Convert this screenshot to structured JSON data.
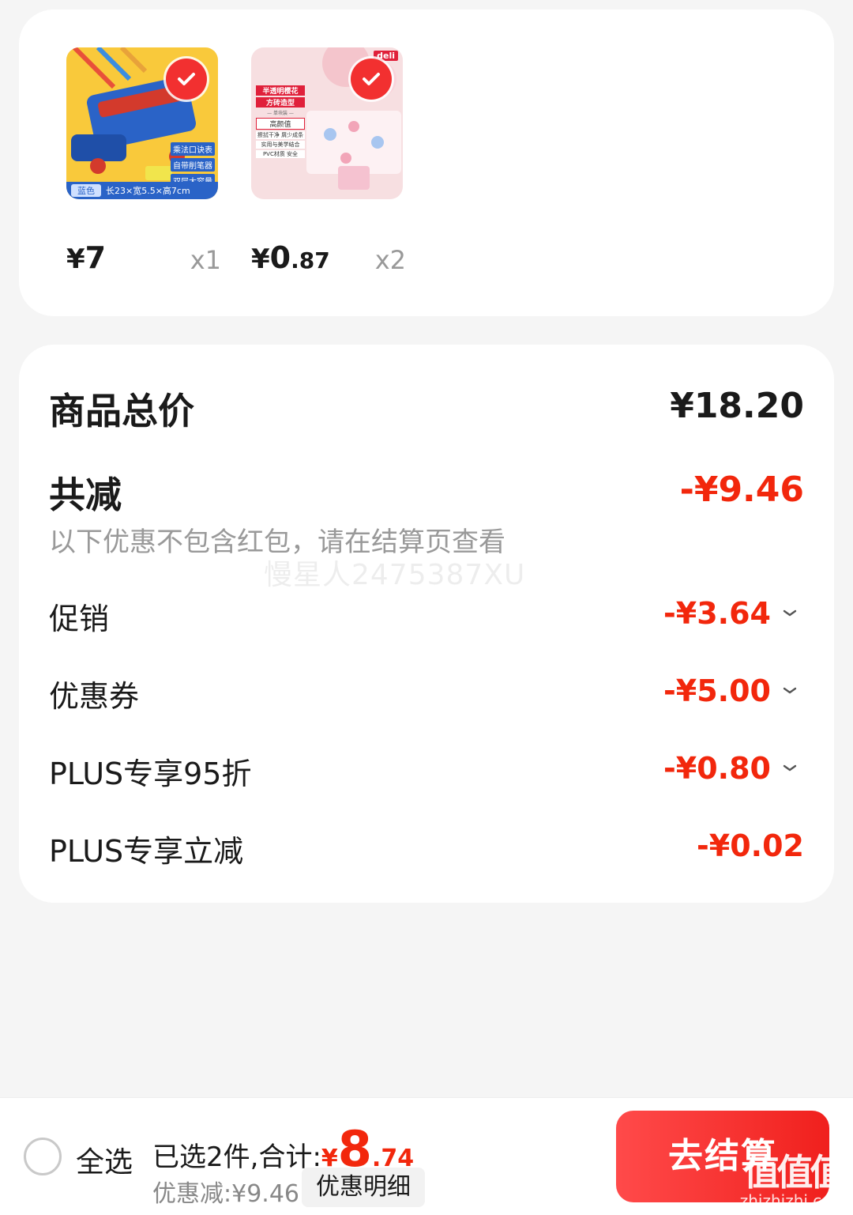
{
  "products": [
    {
      "price_currency": "¥",
      "price_int": "7",
      "price_dec": "",
      "qty": "x1",
      "thumb_labels": [
        "乘法口诀表",
        "自带削笔器",
        "双层大容量"
      ],
      "thumb_footer": [
        "蓝色",
        "长23×宽5.5×高7cm"
      ]
    },
    {
      "price_currency": "¥",
      "price_int": "0",
      "price_dec": ".87",
      "qty": "x2",
      "thumb_brand": "deli",
      "thumb_labels": [
        "半透明樱花",
        "方砖造型",
        "— 单块装 —",
        "高颜值",
        "擦拭干净 屑少成条",
        "实用与美学结合",
        "PVC材质 安全"
      ]
    }
  ],
  "summary": {
    "total_label": "商品总价",
    "total_value": "¥18.20",
    "reduce_label": "共减",
    "reduce_value": "-¥9.46",
    "note": "以下优惠不包含红包，请在结算页查看",
    "watermark": "慢星人2475387XU",
    "items": [
      {
        "label": "促销",
        "value": "-¥3.64",
        "chevron": true
      },
      {
        "label": "优惠券",
        "value": "-¥5.00",
        "chevron": true
      },
      {
        "label": "PLUS专享95折",
        "value": "-¥0.80",
        "chevron": true
      },
      {
        "label": "PLUS专享立减",
        "value": "-¥0.02",
        "chevron": false
      }
    ]
  },
  "bottom_bar": {
    "select_all": "全选",
    "selected_text": "已选2件,合计:",
    "total_currency": "¥",
    "total_int": "8",
    "total_dec": ".74",
    "discount_text": "优惠减:¥9.46",
    "detail_button": "优惠明细",
    "checkout_button": "去结算",
    "brand_mark": "值值值",
    "brand_site": "zhizhizhi.com"
  },
  "colors": {
    "accent_red": "#f2270c",
    "check_red": "#f23030",
    "background": "#f5f5f5"
  },
  "icons": [
    "check-icon",
    "chevron-down-icon",
    "radio-circle-icon"
  ]
}
